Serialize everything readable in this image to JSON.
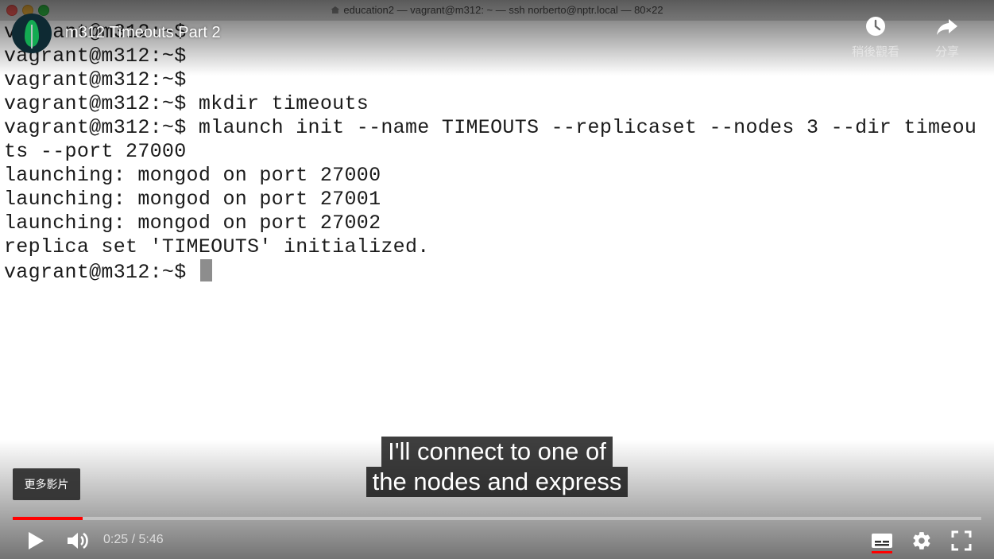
{
  "terminal": {
    "window_title": "education2 — vagrant@m312: ~ — ssh norberto@nptr.local — 80×22",
    "lines": [
      "vagrant@m312:~$",
      "vagrant@m312:~$",
      "vagrant@m312:~$",
      "vagrant@m312:~$ mkdir timeouts",
      "vagrant@m312:~$ mlaunch init --name TIMEOUTS --replicaset --nodes 3 --dir timeou",
      "ts --port 27000",
      "launching: mongod on port 27000",
      "launching: mongod on port 27001",
      "launching: mongod on port 27002",
      "replica set 'TIMEOUTS' initialized.",
      "vagrant@m312:~$ "
    ]
  },
  "video": {
    "title": "m312 Timeouts Part 2",
    "channel_icon": "mongodb-leaf-icon",
    "watch_later_label": "稍後觀看",
    "share_label": "分享",
    "more_videos_label": "更多影片",
    "captions": [
      "I'll connect to one of",
      "the nodes and express"
    ],
    "current_time": "0:25",
    "duration": "5:46",
    "time_display": "0:25 / 5:46",
    "played_fraction": 0.072,
    "loaded_fraction": 0.072
  },
  "controls": {
    "play_icon": "play-icon",
    "volume_icon": "volume-icon",
    "subtitles_icon": "subtitles-icon",
    "settings_icon": "gear-icon",
    "fullscreen_icon": "fullscreen-icon"
  },
  "colors": {
    "progress_played": "#ff0000",
    "mongodb_green": "#13aa52",
    "terminal_text": "#1a1a1a",
    "caption_background": "#080808"
  }
}
